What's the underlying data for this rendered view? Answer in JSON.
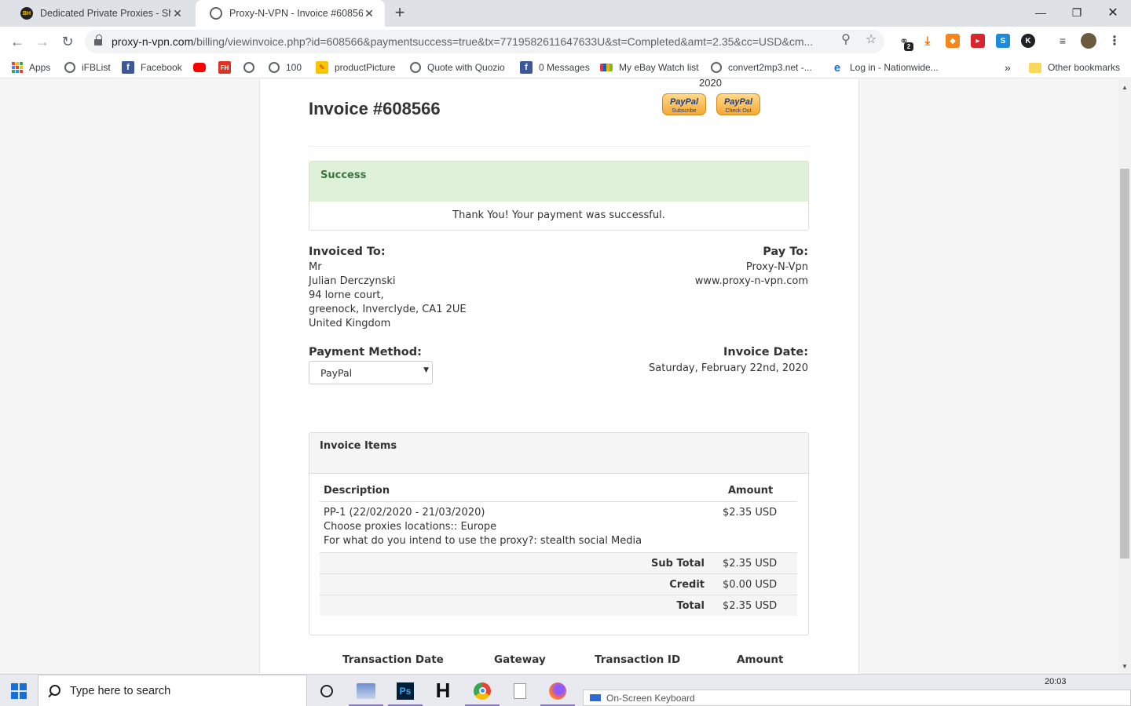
{
  "browser": {
    "tabs": [
      {
        "title": "Dedicated Private Proxies - Share",
        "favicon": "bh-logo-icon"
      },
      {
        "title": "Proxy-N-VPN - Invoice #608566",
        "favicon": "globe-icon"
      }
    ],
    "new_tab": "+",
    "url_host": "proxy-n-vpn.com",
    "url_rest": "/billing/viewinvoice.php?id=608566&paymentsuccess=true&tx=7719582611647633U&st=Completed&amt=2.35&cc=USD&cm...",
    "extension_badge": "2",
    "bookmarks": [
      {
        "label": "Apps",
        "icon": "apps-grid-icon"
      },
      {
        "label": "iFBList",
        "icon": "globe-icon"
      },
      {
        "label": "Facebook",
        "icon": "facebook-icon"
      },
      {
        "label": "",
        "icon": "youtube-icon"
      },
      {
        "label": "FH",
        "icon": "fh-icon"
      },
      {
        "label": "",
        "icon": "globe-icon"
      },
      {
        "label": "100",
        "icon": "globe-icon"
      },
      {
        "label": "productPicture",
        "icon": "picture-icon"
      },
      {
        "label": "Quote with Quozio",
        "icon": "globe-icon"
      },
      {
        "label": "0 Messages",
        "icon": "facebook-icon"
      },
      {
        "label": "My eBay Watch list",
        "icon": "ebay-icon"
      },
      {
        "label": "convert2mp3.net -...",
        "icon": "globe-icon"
      },
      {
        "label": "Log in - Nationwide...",
        "icon": "ie-icon"
      }
    ],
    "bookmarks_overflow": "»",
    "other_bookmarks": "Other bookmarks"
  },
  "page": {
    "year_fragment": "2020",
    "paypal_buttons": [
      {
        "brand": "PayPal",
        "sub": "Subscribe"
      },
      {
        "brand": "PayPal",
        "sub": "Check Out"
      }
    ],
    "invoice_title": "Invoice #608566",
    "alert": {
      "title": "Success",
      "message": "Thank You! Your payment was successful."
    },
    "invoiced_to": {
      "label": "Invoiced To:",
      "lines": [
        "Mr",
        "Julian Derczynski",
        "94 lorne court,",
        "greenock, Inverclyde, CA1 2UE",
        "United Kingdom"
      ]
    },
    "pay_to": {
      "label": "Pay To:",
      "lines": [
        "Proxy-N-Vpn",
        "www.proxy-n-vpn.com"
      ]
    },
    "payment_method": {
      "label": "Payment Method:",
      "selected": "PayPal"
    },
    "invoice_date": {
      "label": "Invoice Date:",
      "value": "Saturday, February 22nd, 2020"
    },
    "items_panel": {
      "title": "Invoice Items",
      "col_description": "Description",
      "col_amount": "Amount",
      "item_lines": [
        "PP-1 (22/02/2020 - 21/03/2020)",
        "Choose proxies locations:: Europe",
        "For what do you intend to use the proxy?: stealth social Media"
      ],
      "item_amount": "$2.35 USD",
      "totals": [
        {
          "label": "Sub Total",
          "value": "$2.35 USD"
        },
        {
          "label": "Credit",
          "value": "$0.00 USD"
        },
        {
          "label": "Total",
          "value": "$2.35 USD"
        }
      ]
    },
    "transactions_header": [
      "Transaction Date",
      "Gateway",
      "Transaction ID",
      "Amount"
    ]
  },
  "taskbar": {
    "search_placeholder": "Type here to search",
    "on_screen_keyboard": "On-Screen Keyboard",
    "clock": "20:03"
  }
}
